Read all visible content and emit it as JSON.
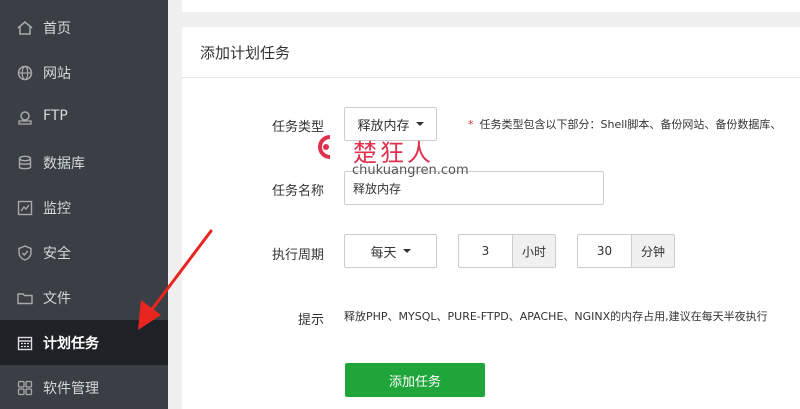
{
  "sidebar": {
    "items": [
      {
        "label": "首页",
        "icon": "home-icon"
      },
      {
        "label": "网站",
        "icon": "globe-icon"
      },
      {
        "label": "FTP",
        "icon": "ftp-icon"
      },
      {
        "label": "数据库",
        "icon": "database-icon"
      },
      {
        "label": "监控",
        "icon": "monitor-icon"
      },
      {
        "label": "安全",
        "icon": "shield-icon"
      },
      {
        "label": "文件",
        "icon": "folder-icon"
      },
      {
        "label": "计划任务",
        "icon": "calendar-icon",
        "active": true
      },
      {
        "label": "软件管理",
        "icon": "grid-icon"
      }
    ]
  },
  "panel": {
    "title": "添加计划任务",
    "task_type": {
      "label": "任务类型",
      "value": "释放内存",
      "hint_star": "*",
      "hint": "任务类型包含以下部分：Shell脚本、备份网站、备份数据库、"
    },
    "task_name": {
      "label": "任务名称",
      "value": "释放内存"
    },
    "period": {
      "label": "执行周期",
      "frequency": "每天",
      "hour_value": "3",
      "hour_unit": "小时",
      "minute_value": "30",
      "minute_unit": "分钟"
    },
    "tip": {
      "label": "提示",
      "text": "释放PHP、MYSQL、PURE-FTPD、APACHE、NGINX的内存占用,建议在每天半夜执行"
    },
    "submit_label": "添加任务"
  },
  "watermark": {
    "brand": "楚狂人",
    "url": "chukuangren.com"
  },
  "colors": {
    "sidebar_bg": "#3a3f45",
    "sidebar_active_bg": "#1e2125",
    "primary_green": "#20a53a",
    "watermark_red": "#e0314f",
    "annotation_red": "#e8261f"
  }
}
